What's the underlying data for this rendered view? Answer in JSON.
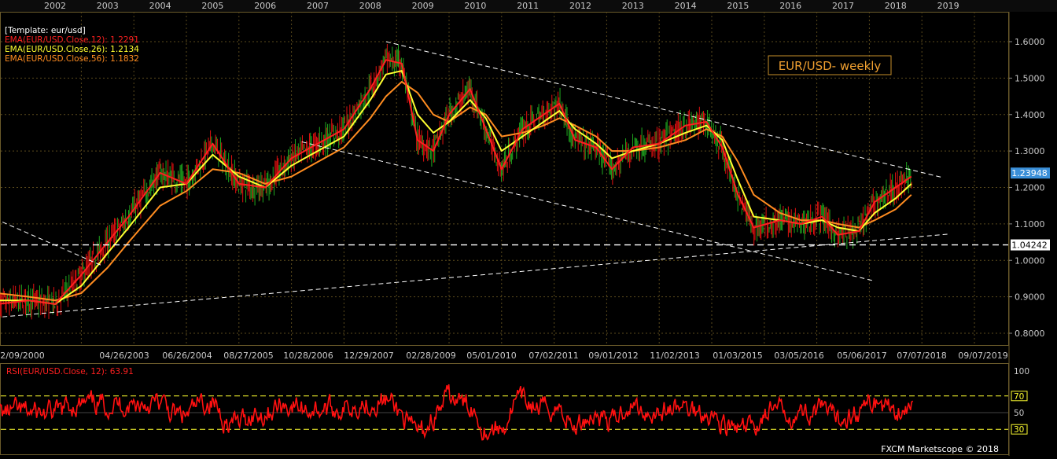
{
  "template_label": "[Template: eur/usd]",
  "legend": [
    {
      "label": "EMA(EUR/USD.Close,12): 1.2291",
      "color": "#ff2020"
    },
    {
      "label": "EMA(EUR/USD.Close,26): 1.2134",
      "color": "#ffff30"
    },
    {
      "label": "EMA(EUR/USD.Close,56): 1.1832",
      "color": "#ff8c20"
    }
  ],
  "chart_title": "EUR/USD- weekly",
  "year_labels": [
    "2002",
    "2003",
    "2004",
    "2005",
    "2006",
    "2007",
    "2008",
    "2009",
    "2010",
    "2011",
    "2012",
    "2013",
    "2014",
    "2015",
    "2016",
    "2017",
    "2018",
    "2019"
  ],
  "date_labels": [
    "12/09/2000",
    "04/26/2003",
    "06/26/2004",
    "08/27/2005",
    "10/28/2006",
    "12/29/2007",
    "02/28/2009",
    "05/01/2010",
    "07/02/2011",
    "09/01/2012",
    "11/02/2013",
    "01/03/2015",
    "03/05/2016",
    "05/06/2017",
    "07/07/2018",
    "09/07/2019"
  ],
  "price_ticks": [
    "1.6000",
    "1.5000",
    "1.4000",
    "1.3000",
    "1.2000",
    "1.1000",
    "1.0000",
    "0.9000",
    "0.8000"
  ],
  "price_badges": {
    "current": "1.23948",
    "support": "1.04242"
  },
  "rsi": {
    "label": "RSI(EUR/USD.Close, 12): 63.91",
    "ticks": [
      "100",
      "70",
      "50",
      "30"
    ]
  },
  "copyright": "FXCM Marketscope © 2018",
  "colors": {
    "price_up": "#1fa81f",
    "price_down": "#e01010",
    "ema12": "#ff2020",
    "ema26": "#ffff30",
    "ema56": "#ff8c20",
    "rsi": "#ff1010",
    "grid": "#5a4a1c",
    "dashed_levels": "#ffff30",
    "trendlines": "#ffffff",
    "title_box": "#c8902a"
  },
  "chart_data": {
    "type": "line",
    "title": "EUR/USD- weekly",
    "y_range": [
      0.78,
      1.64
    ],
    "x_range_years": [
      2000.9,
      2019.9
    ],
    "series": [
      {
        "name": "EMA(EUR/USD.Close,12)",
        "x": [
          2000.9,
          2001.5,
          2002.0,
          2002.5,
          2003.0,
          2003.4,
          2004.0,
          2004.5,
          2005.0,
          2005.5,
          2006.0,
          2006.5,
          2007.0,
          2007.5,
          2008.0,
          2008.3,
          2008.6,
          2008.9,
          2009.2,
          2009.5,
          2009.9,
          2010.2,
          2010.5,
          2010.9,
          2011.3,
          2011.6,
          2011.9,
          2012.3,
          2012.6,
          2013.0,
          2013.5,
          2014.0,
          2014.4,
          2014.7,
          2015.0,
          2015.3,
          2015.8,
          2016.2,
          2016.6,
          2016.9,
          2017.3,
          2017.6,
          2018.0,
          2018.3
        ],
        "y": [
          0.88,
          0.89,
          0.88,
          0.96,
          1.05,
          1.12,
          1.24,
          1.21,
          1.32,
          1.21,
          1.2,
          1.28,
          1.32,
          1.36,
          1.47,
          1.55,
          1.54,
          1.33,
          1.3,
          1.4,
          1.47,
          1.36,
          1.25,
          1.36,
          1.4,
          1.43,
          1.33,
          1.31,
          1.25,
          1.31,
          1.32,
          1.37,
          1.38,
          1.31,
          1.18,
          1.09,
          1.11,
          1.1,
          1.12,
          1.07,
          1.08,
          1.16,
          1.2,
          1.23
        ]
      },
      {
        "name": "EMA(EUR/USD.Close,26)",
        "x": [
          2000.9,
          2001.5,
          2002.0,
          2002.5,
          2003.0,
          2003.4,
          2004.0,
          2004.5,
          2005.0,
          2005.5,
          2006.0,
          2006.5,
          2007.0,
          2007.5,
          2008.0,
          2008.3,
          2008.6,
          2008.9,
          2009.2,
          2009.5,
          2009.9,
          2010.2,
          2010.5,
          2010.9,
          2011.3,
          2011.6,
          2011.9,
          2012.3,
          2012.6,
          2013.0,
          2013.5,
          2014.0,
          2014.4,
          2014.7,
          2015.0,
          2015.3,
          2015.8,
          2016.2,
          2016.6,
          2016.9,
          2017.3,
          2017.6,
          2018.0,
          2018.3
        ],
        "y": [
          0.89,
          0.89,
          0.88,
          0.93,
          1.02,
          1.09,
          1.2,
          1.21,
          1.29,
          1.23,
          1.2,
          1.26,
          1.3,
          1.34,
          1.44,
          1.51,
          1.52,
          1.4,
          1.35,
          1.38,
          1.44,
          1.39,
          1.3,
          1.34,
          1.38,
          1.41,
          1.36,
          1.32,
          1.28,
          1.3,
          1.32,
          1.35,
          1.37,
          1.33,
          1.22,
          1.12,
          1.11,
          1.1,
          1.11,
          1.09,
          1.08,
          1.13,
          1.17,
          1.21
        ]
      },
      {
        "name": "EMA(EUR/USD.Close,56)",
        "x": [
          2000.9,
          2001.5,
          2002.0,
          2002.5,
          2003.0,
          2003.4,
          2004.0,
          2004.5,
          2005.0,
          2005.5,
          2006.0,
          2006.5,
          2007.0,
          2007.5,
          2008.0,
          2008.3,
          2008.6,
          2008.9,
          2009.2,
          2009.5,
          2009.9,
          2010.2,
          2010.5,
          2010.9,
          2011.3,
          2011.6,
          2011.9,
          2012.3,
          2012.6,
          2013.0,
          2013.5,
          2014.0,
          2014.4,
          2014.7,
          2015.0,
          2015.3,
          2015.8,
          2016.2,
          2016.6,
          2016.9,
          2017.3,
          2017.6,
          2018.0,
          2018.3
        ],
        "y": [
          0.91,
          0.9,
          0.89,
          0.91,
          0.98,
          1.05,
          1.15,
          1.19,
          1.25,
          1.24,
          1.21,
          1.23,
          1.27,
          1.31,
          1.39,
          1.45,
          1.49,
          1.46,
          1.4,
          1.38,
          1.42,
          1.4,
          1.34,
          1.35,
          1.37,
          1.39,
          1.37,
          1.34,
          1.3,
          1.3,
          1.31,
          1.33,
          1.36,
          1.34,
          1.27,
          1.18,
          1.13,
          1.11,
          1.11,
          1.1,
          1.09,
          1.11,
          1.14,
          1.18
        ]
      }
    ],
    "levels": {
      "current": 1.23948,
      "support": 1.04242
    },
    "rsi_series": {
      "name": "RSI(EUR/USD.Close, 12)",
      "latest": 63.91,
      "y_range": [
        0,
        100
      ],
      "levels": [
        70,
        50,
        30
      ]
    }
  }
}
